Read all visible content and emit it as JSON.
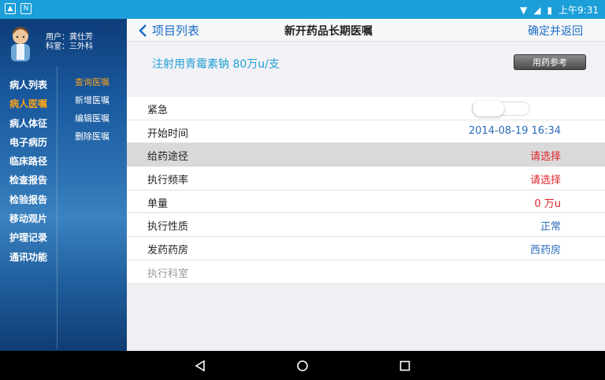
{
  "statusbar": {
    "left_icons": [
      "notification-icon",
      "n-icon"
    ],
    "time": "上午9:31"
  },
  "sidebar": {
    "user_label": "用户：",
    "user_name": "龚仕芳",
    "dept_label": "科室：",
    "dept_name": "三外科",
    "menu_left": [
      "病人列表",
      "病人医嘱",
      "病人体征",
      "电子病历",
      "临床路径",
      "检查报告",
      "检验报告",
      "移动观片",
      "护理记录",
      "通讯功能"
    ],
    "menu_right": [
      "查询医嘱",
      "新增医嘱",
      "编辑医嘱",
      "删除医嘱"
    ]
  },
  "nav": {
    "back_label": "项目列表",
    "title": "新开药品长期医嘱",
    "confirm_label": "确定并返回"
  },
  "drug": {
    "name": "注射用青霉素钠 80万u/支",
    "ref_button": "用药参考"
  },
  "rows": [
    {
      "label": "紧急",
      "value": "",
      "toggle": false
    },
    {
      "label": "开始时间",
      "value": "2014-08-19 16:34"
    },
    {
      "label": "给药途径",
      "value": "请选择"
    },
    {
      "label": "执行频率",
      "value": "请选择"
    },
    {
      "label": "单量",
      "value": "0 万u"
    },
    {
      "label": "执行性质",
      "value": "正常"
    },
    {
      "label": "发药药房",
      "value": "西药房"
    },
    {
      "label": "执行科室",
      "value": ""
    }
  ],
  "colors": {
    "statusbar": "#1c9fd9",
    "accent": "#1a6dc9",
    "warning": "#e0262a",
    "active_menu": "#f6a21c"
  }
}
